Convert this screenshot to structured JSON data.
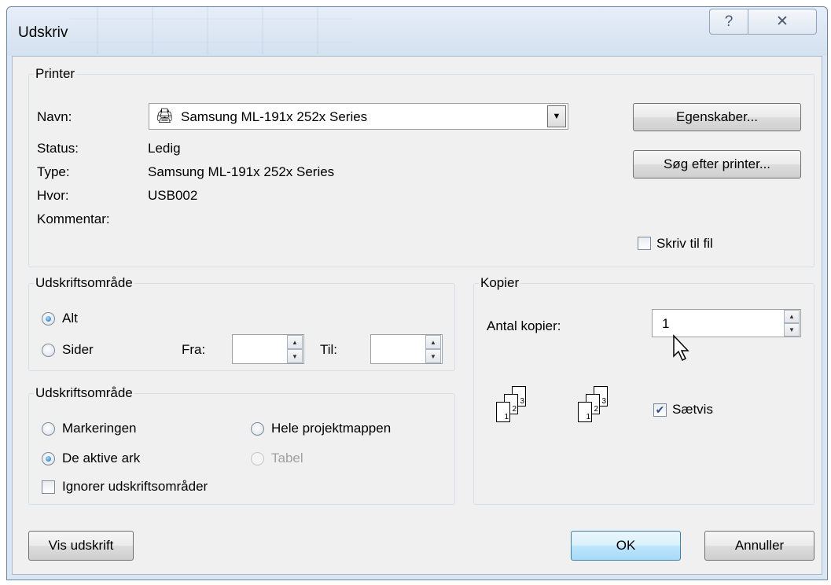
{
  "window": {
    "title": "Udskriv"
  },
  "caption_buttons": {
    "help": "?",
    "close": "✕"
  },
  "printer": {
    "group_label": "Printer",
    "name_label": "Navn:",
    "name_value": "Samsung ML-191x 252x Series",
    "status_label": "Status:",
    "status_value": "Ledig",
    "type_label": "Type:",
    "type_value": "Samsung ML-191x 252x Series",
    "where_label": "Hvor:",
    "where_value": "USB002",
    "comment_label": "Kommentar:",
    "properties_button": "Egenskaber...",
    "find_printer_button": "Søg efter printer...",
    "print_to_file_label": "Skriv til fil",
    "print_to_file_checked": false
  },
  "print_range": {
    "group_label": "Udskriftsområde",
    "all_label": "Alt",
    "pages_label": "Sider",
    "from_label": "Fra:",
    "to_label": "Til:",
    "selected": "all"
  },
  "print_what": {
    "group_label": "Udskriftsområde",
    "selection_label": "Markeringen",
    "entire_workbook_label": "Hele projektmappen",
    "active_sheets_label": "De aktive ark",
    "table_label": "Tabel",
    "ignore_areas_label": "Ignorer udskriftsområder",
    "selected": "active_sheets"
  },
  "copies": {
    "group_label": "Kopier",
    "count_label": "Antal kopier:",
    "count_value": "1",
    "collate_label": "Sætvis",
    "collate_checked": true,
    "page_numbers": [
      "1",
      "2",
      "3"
    ]
  },
  "footer": {
    "preview_button": "Vis udskrift",
    "ok_button": "OK",
    "cancel_button": "Annuller"
  }
}
